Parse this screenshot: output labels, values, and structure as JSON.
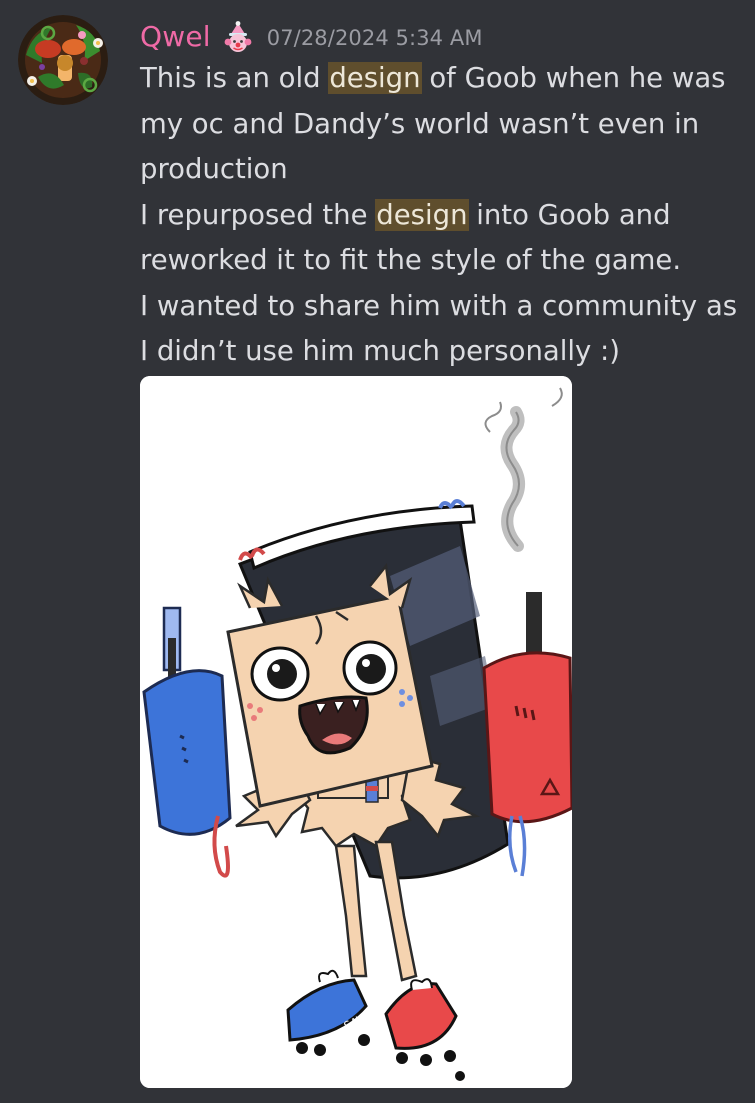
{
  "message": {
    "author": "Qwel",
    "author_color": "#ef6aa6",
    "role_icon": "clown-icon",
    "timestamp": "07/28/2024 5:34 AM",
    "highlight_term": "design",
    "highlight_color": "#5f4e2d",
    "content_lines": [
      {
        "before": "This is an old ",
        "highlight": "design",
        "after": " of Goob when he was"
      },
      {
        "before": "my oc and Dandy’s world wasn’t even in",
        "highlight": "",
        "after": ""
      },
      {
        "before": "production",
        "highlight": "",
        "after": ""
      },
      {
        "before": "I repurposed the ",
        "highlight": "design",
        "after": " into Goob and"
      },
      {
        "before": "reworked it to fit the style of the game.",
        "highlight": "",
        "after": ""
      },
      {
        "before": "I wanted to share him with a community as",
        "highlight": "",
        "after": ""
      },
      {
        "before": "I didn’t use him much personally :)",
        "highlight": "",
        "after": ""
      }
    ],
    "attachment": {
      "type": "image",
      "icon": "character-drawing",
      "signature": "SAV-"
    }
  },
  "theme": {
    "background": "#313338",
    "text": "#dcdde1",
    "timestamp": "#9b9ca3"
  }
}
